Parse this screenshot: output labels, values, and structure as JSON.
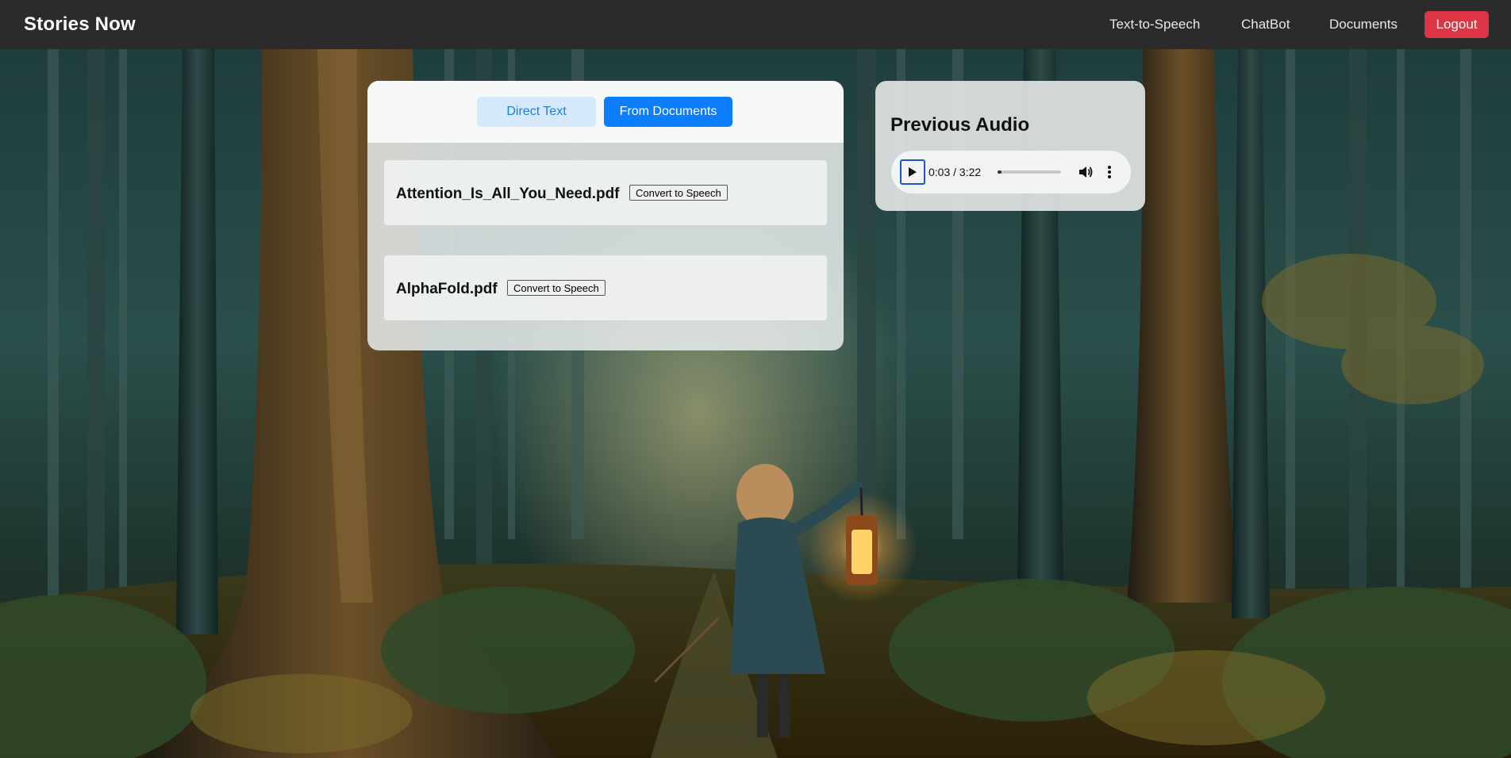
{
  "navbar": {
    "brand": "Stories Now",
    "links": [
      "Text-to-Speech",
      "ChatBot",
      "Documents"
    ],
    "logout_label": "Logout"
  },
  "tabs": {
    "direct_text": "Direct Text",
    "from_documents": "From Documents",
    "active": "From Documents"
  },
  "documents": [
    {
      "name": "Attention_Is_All_You_Need.pdf",
      "action": "Convert to Speech"
    },
    {
      "name": "AlphaFold.pdf",
      "action": "Convert to Speech"
    }
  ],
  "audio": {
    "title": "Previous Audio",
    "time_display": "0:03 / 3:22",
    "progress_fraction": 0.0155,
    "icons": [
      "play-icon",
      "volume-icon",
      "more-options-icon"
    ]
  },
  "colors": {
    "navbar_bg": "#2b2b2b",
    "logout_bg": "#dc3545",
    "active_tab_bg": "#0d7efb",
    "inactive_tab_bg": "#d6e9fb",
    "inactive_tab_text": "#1b7ee0"
  }
}
